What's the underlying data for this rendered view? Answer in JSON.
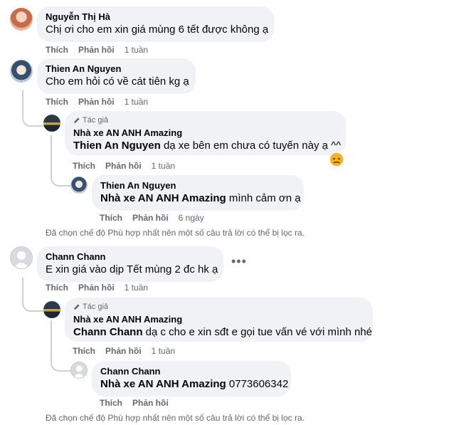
{
  "comments": [
    {
      "name": "Nguyễn Thị Hà",
      "text": "Chị ơi cho em xin giá mùng 6 tết được không ạ",
      "like": "Thích",
      "reply": "Phản hồi",
      "time": "1 tuần"
    },
    {
      "name": "Thien An Nguyen",
      "text": "Cho em hỏi có về cát tiên kg ạ",
      "like": "Thích",
      "reply": "Phản hồi",
      "time": "1 tuần"
    },
    {
      "badge": "Tác giả",
      "name": "Nhà xe AN ANH Amazing",
      "tag": "Thien An Nguyen",
      "text": " dạ xe bên em chưa có tuyến này ạ ^^",
      "like": "Thích",
      "reply": "Phản hồi",
      "time": "1 tuần"
    },
    {
      "name": "Thien An Nguyen",
      "tag": "Nhà xe AN ANH Amazing",
      "text": " mình cảm ơn ạ",
      "like": "Thích",
      "reply": "Phản hồi",
      "time": "6 ngày"
    },
    {
      "name": "Chann Chann",
      "text": "E xin giá vào dịp Tết mùng 2 đc hk ạ",
      "like": "Thích",
      "reply": "Phản hồi",
      "time": "1 tuần"
    },
    {
      "badge": "Tác giả",
      "name": "Nhà xe AN ANH Amazing",
      "tag": "Chann Chann",
      "text": " dạ c cho e xin sđt e gọi tue vấn vé với mình nhé",
      "like": "Thích",
      "reply": "Phản hồi",
      "time": "1 tuần"
    },
    {
      "name": "Chann Chann",
      "tag": "Nhà xe AN ANH Amazing",
      "text": " 0773606342",
      "like": "Thích",
      "reply": "Phản hồi",
      "time": ""
    }
  ],
  "filtered_notice_1": "Đã chọn chế độ Phù hợp nhất nên một số câu trả lời có thể bị lọc ra.",
  "filtered_notice_2": "Đã chọn chế độ Phù hợp nhất nên một số câu trả lời có thể bị lọc ra.",
  "more_glyph": "•••",
  "colors": {
    "bubble": "#f0f2f5",
    "secondary_text": "#65676b",
    "thread_line": "#ced0d4"
  }
}
